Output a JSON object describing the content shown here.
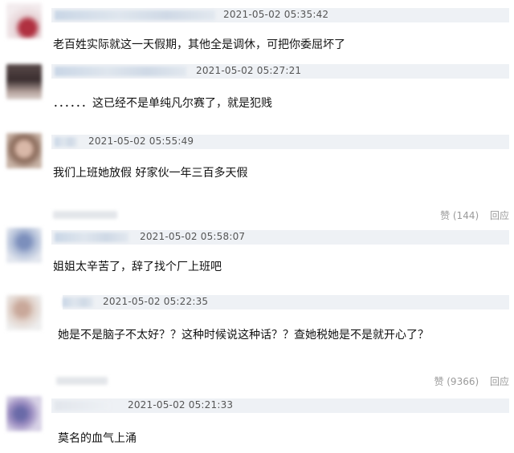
{
  "comments": [
    {
      "timestamp": "2021-05-02 05:35:42",
      "text": "老百姓实际就这一天假期，其他全是调休，可把你委屈坏了"
    },
    {
      "timestamp": "2021-05-02 05:27:21",
      "text": "．．．．．．这已经不是单纯凡尔赛了，就是犯贱"
    },
    {
      "timestamp": "2021-05-02 05:55:49",
      "text": "我们上班她放假 好家伙一年三百多天假"
    },
    {
      "timestamp": "2021-05-02 05:58:07",
      "text": "姐姐太辛苦了，辞了找个厂上班吧"
    },
    {
      "timestamp": "2021-05-02 05:22:35",
      "text": "她是不是脑子不太好？？这种时候说这种话？？查她税她是不是就开心了？"
    },
    {
      "timestamp": "2021-05-02 05:21:33",
      "text": "莫名的血气上涌"
    }
  ],
  "footers": [
    {
      "like_label": "赞 (144)",
      "reply_label": "回应"
    },
    {
      "like_label": "赞 (9366)",
      "reply_label": "回应"
    }
  ],
  "colors": {
    "header_bg": "#eef1f5",
    "meta_text": "#9a9a9a"
  }
}
